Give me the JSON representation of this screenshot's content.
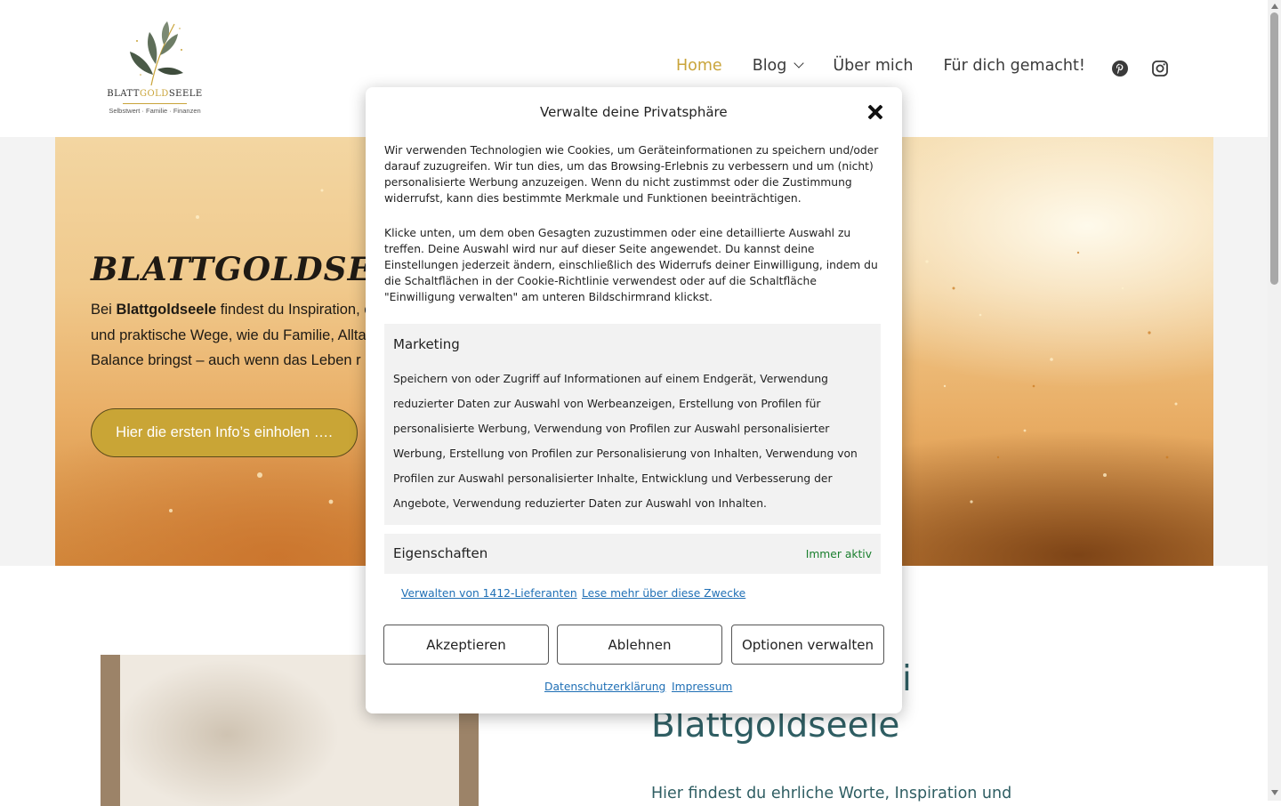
{
  "header": {
    "logo": {
      "name_part1": "BLATT",
      "name_part2": "GOLD",
      "name_part3": "SEELE",
      "tagline": "Selbstwert · Familie · Finanzen"
    },
    "nav": {
      "home": "Home",
      "blog": "Blog",
      "about": "Über mich",
      "made_for_you": "Für dich gemacht!"
    },
    "active_color": "#c9a43a"
  },
  "hero": {
    "title": "BLATTGOLDSEELE",
    "text_prefix": "Bei ",
    "text_bold": "Blattgoldseele",
    "text_rest": " findest du Inspiration, e und praktische Wege, wie du Familie, Allta in Balance bringst – auch wenn das Leben r",
    "button": "Hier die ersten Info’s einholen ….",
    "button_color": "#c9a536"
  },
  "section": {
    "heading_line1": "ei",
    "heading_line2": "Blattgoldseele",
    "subtext": "Hier findest du ehrliche Worte, Inspiration und"
  },
  "cookie_modal": {
    "title": "Verwalte deine Privatsphäre",
    "paragraph1": "Wir verwenden Technologien wie Cookies, um Geräteinformationen zu speichern und/oder darauf zuzugreifen. Wir tun dies, um das Browsing-Erlebnis zu verbessern und um (nicht) personalisierte Werbung anzuzeigen. Wenn du nicht zustimmst oder die Zustimmung widerrufst, kann dies bestimmte Merkmale und Funktionen beeinträchtigen.",
    "paragraph2": "Klicke unten, um dem oben Gesagten zuzustimmen oder eine detaillierte Auswahl zu treffen. Deine Auswahl wird nur auf dieser Seite angewendet. Du kannst deine Einstellungen jederzeit ändern, einschließlich des Widerrufs deiner Einwilligung, indem du die Schaltflächen in der Cookie-Richtlinie verwendest oder auf die Schaltfläche \"Einwilligung verwalten\" am unteren Bildschirmrand klickst.",
    "marketing_title": "Marketing",
    "marketing_desc": "Speichern von oder Zugriff auf Informationen auf einem Endgerät, Verwendung reduzierter Daten zur Auswahl von Werbeanzeigen, Erstellung von Profilen für personalisierte Werbung, Verwendung von Profilen zur Auswahl personalisierter Werbung, Erstellung von Profilen zur Personalisierung von Inhalten, Verwendung von Profilen zur Auswahl personalisierter Inhalte, Entwicklung und Verbesserung der Angebote, Verwendung reduzierter Daten zur Auswahl von Inhalten.",
    "properties_title": "Eigenschaften",
    "always_active": "Immer aktiv",
    "link_vendors": "Verwalten von 1412-Lieferanten",
    "link_purposes": "Lese mehr über diese Zwecke",
    "accept": "Akzeptieren",
    "deny": "Ablehnen",
    "manage": "Optionen verwalten",
    "privacy": "Datenschutzerklärung",
    "imprint": "Impressum",
    "always_active_color": "#1a7f2e",
    "link_color": "#1f6fb5"
  },
  "icons": [
    "pinterest-icon",
    "instagram-icon",
    "close-icon",
    "chevron-down-icon",
    "leaf-logo-icon"
  ]
}
